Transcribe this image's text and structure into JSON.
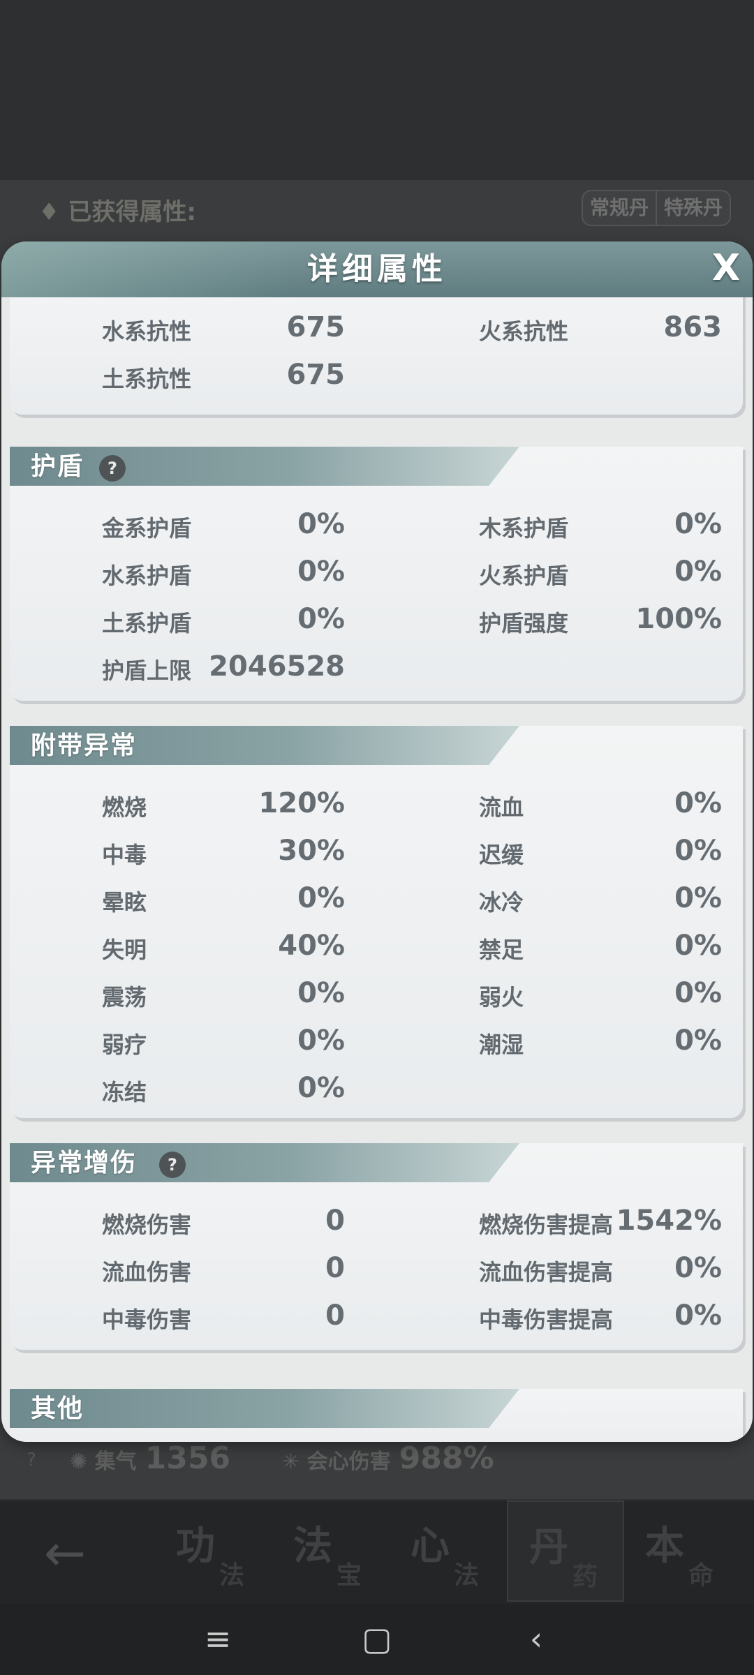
{
  "background": {
    "header_label": "♦ 已获得属性:",
    "tabs": [
      "常规丹",
      "特殊丹"
    ],
    "stats": [
      {
        "label": "集气",
        "value": "1356"
      },
      {
        "label": "会心伤害",
        "value": "988%"
      }
    ]
  },
  "bottom_nav": {
    "tabs": [
      {
        "big": "功",
        "small": "法"
      },
      {
        "big": "法",
        "small": "宝"
      },
      {
        "big": "心",
        "small": "法"
      },
      {
        "big": "丹",
        "small": "药"
      },
      {
        "big": "本",
        "small": "命"
      }
    ],
    "active_index": 3
  },
  "dialog": {
    "title": "详细属性",
    "close_label": "X",
    "resistance": {
      "items": [
        {
          "label": "水系抗性",
          "value": "675"
        },
        {
          "label": "火系抗性",
          "value": "863"
        },
        {
          "label": "土系抗性",
          "value": "675"
        }
      ]
    },
    "shield": {
      "title": "护盾",
      "items": [
        {
          "label": "金系护盾",
          "value": "0%"
        },
        {
          "label": "木系护盾",
          "value": "0%"
        },
        {
          "label": "水系护盾",
          "value": "0%"
        },
        {
          "label": "火系护盾",
          "value": "0%"
        },
        {
          "label": "土系护盾",
          "value": "0%"
        },
        {
          "label": "护盾强度",
          "value": "100%"
        },
        {
          "label": "护盾上限",
          "value": "2046528"
        }
      ]
    },
    "abnormal": {
      "title": "附带异常",
      "items": [
        {
          "label": "燃烧",
          "value": "120%"
        },
        {
          "label": "流血",
          "value": "0%"
        },
        {
          "label": "中毒",
          "value": "30%"
        },
        {
          "label": "迟缓",
          "value": "0%"
        },
        {
          "label": "晕眩",
          "value": "0%"
        },
        {
          "label": "冰冷",
          "value": "0%"
        },
        {
          "label": "失明",
          "value": "40%"
        },
        {
          "label": "禁足",
          "value": "0%"
        },
        {
          "label": "震荡",
          "value": "0%"
        },
        {
          "label": "弱火",
          "value": "0%"
        },
        {
          "label": "弱疗",
          "value": "0%"
        },
        {
          "label": "潮湿",
          "value": "0%"
        },
        {
          "label": "冻结",
          "value": "0%"
        }
      ]
    },
    "abnormal_damage": {
      "title": "异常增伤",
      "items": [
        {
          "label": "燃烧伤害",
          "value": "0"
        },
        {
          "label": "燃烧伤害提高",
          "value": "1542%"
        },
        {
          "label": "流血伤害",
          "value": "0"
        },
        {
          "label": "流血伤害提高",
          "value": "0%"
        },
        {
          "label": "中毒伤害",
          "value": "0"
        },
        {
          "label": "中毒伤害提高",
          "value": "0%"
        }
      ]
    },
    "other": {
      "title": "其他"
    }
  }
}
